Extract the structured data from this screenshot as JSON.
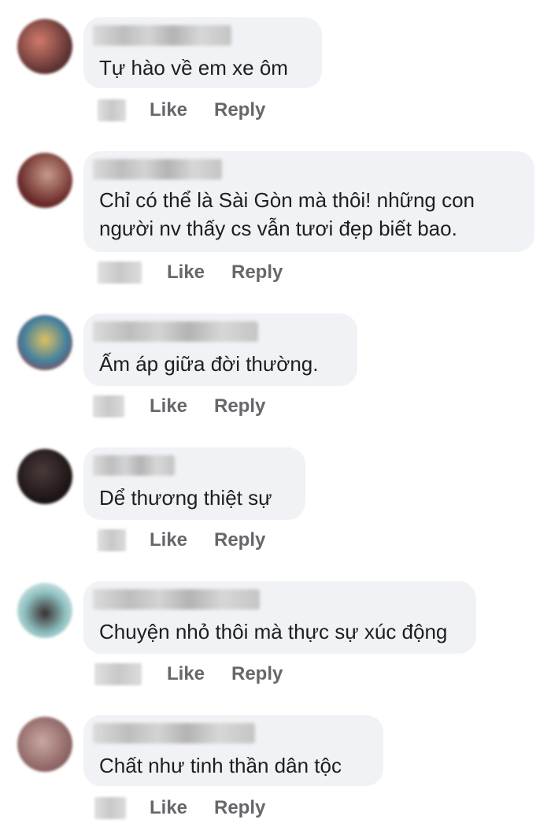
{
  "actions": {
    "like_label": "Like",
    "reply_label": "Reply"
  },
  "comments": [
    {
      "text": "Tự hào về em xe ôm",
      "avatar_color": "#8a5a4a"
    },
    {
      "text": "Chỉ có thể là Sài Gòn mà thôi! những con\nngười nv thấy cs vẫn tươi đẹp biết bao.",
      "avatar_color": "#7a3a3a"
    },
    {
      "text": "Ấm áp giữa đời thường.",
      "avatar_color": "#3f7fa0"
    },
    {
      "text": "Dể thương thiệt sự",
      "avatar_color": "#2a1f1f"
    },
    {
      "text": "Chuyện nhỏ thôi mà thực sự xúc động",
      "avatar_color": "#6fa8a8"
    },
    {
      "text": "Chất như tinh thần dân tộc",
      "avatar_color": "#a07a7a"
    }
  ]
}
